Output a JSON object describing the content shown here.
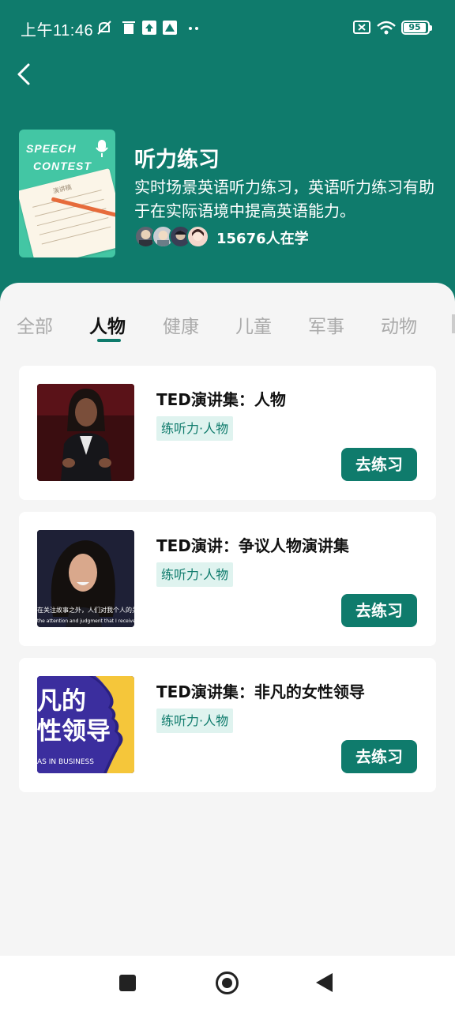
{
  "status_bar": {
    "time": "上午11:46",
    "battery": "95",
    "icons": [
      "bell-muted-icon",
      "trash-icon",
      "upload-icon",
      "app-icon",
      "more-dots-icon",
      "sim-off-icon",
      "wifi-icon",
      "battery-icon"
    ]
  },
  "colors": {
    "primary": "#0f7b6c",
    "tag_bg": "#dff3ef",
    "background": "#f5f5f5"
  },
  "header": {
    "back_icon": "chevron-left-icon",
    "cover_line1": "SPEECH",
    "cover_line2": "CONTEST",
    "cover_paper_text": "演讲稿",
    "title": "听力练习",
    "description": "实时场景英语听力练习，英语听力练习有助于在实际语境中提高英语能力。",
    "learners": "15676人在学"
  },
  "tabs": [
    {
      "label": "全部",
      "active": false
    },
    {
      "label": "人物",
      "active": true
    },
    {
      "label": "健康",
      "active": false
    },
    {
      "label": "儿童",
      "active": false
    },
    {
      "label": "军事",
      "active": false
    },
    {
      "label": "动物",
      "active": false
    }
  ],
  "courses": [
    {
      "title": "TED演讲集：人物",
      "tag": "练听力·人物",
      "button": "去练习"
    },
    {
      "title": "TED演讲：争议人物演讲集",
      "tag": "练听力·人物",
      "button": "去练习",
      "thumb_subtitle_cn": "在关注故事之外，人们对我个人的关注",
      "thumb_subtitle_en": "the attention and judgment that I received, not the story"
    },
    {
      "title": "TED演讲集：非凡的女性领导",
      "tag": "练听力·人物",
      "button": "去练习",
      "thumb_line1": "凡的",
      "thumb_line2": "性领导",
      "thumb_small": "AS IN BUSINESS"
    }
  ],
  "nav_bar": {
    "icons": [
      "recent-apps-icon",
      "home-icon",
      "back-icon"
    ]
  }
}
